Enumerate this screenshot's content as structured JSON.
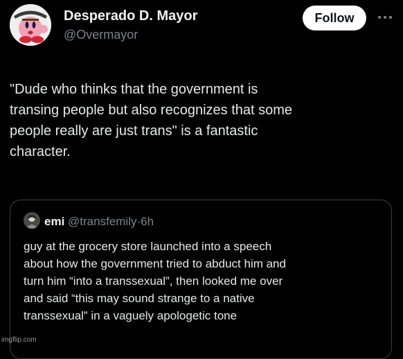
{
  "tweet": {
    "author": {
      "display_name": "Desperado D. Mayor",
      "handle": "@Overmayor",
      "avatar_icon": "kirby-avatar-icon"
    },
    "follow_label": "Follow",
    "more_icon": "more-horizontal-icon",
    "lines": [
      "\"Dude who thinks that the government is",
      "transing people but also recognizes that some",
      "people really are just trans\" is a fantastic",
      "character."
    ]
  },
  "quoted_tweet": {
    "display_name": "emi",
    "handle": "@transfemily",
    "separator": "·",
    "time": "6h",
    "lines": [
      "guy at the grocery store launched into a speech",
      "about how the government tried to abduct him and",
      "turn him “into a transsexual”, then looked me over",
      "and said “this may sound strange to a native",
      "transsexual” in a vaguely apologetic tone"
    ]
  },
  "watermark": "imgflip.com",
  "colors": {
    "background": "#000000",
    "text_primary": "#e7e9ea",
    "text_secondary": "#7c8389",
    "card_border": "#3a3f44",
    "follow_button_bg": "#ffffff",
    "follow_button_text": "#0f1419"
  }
}
